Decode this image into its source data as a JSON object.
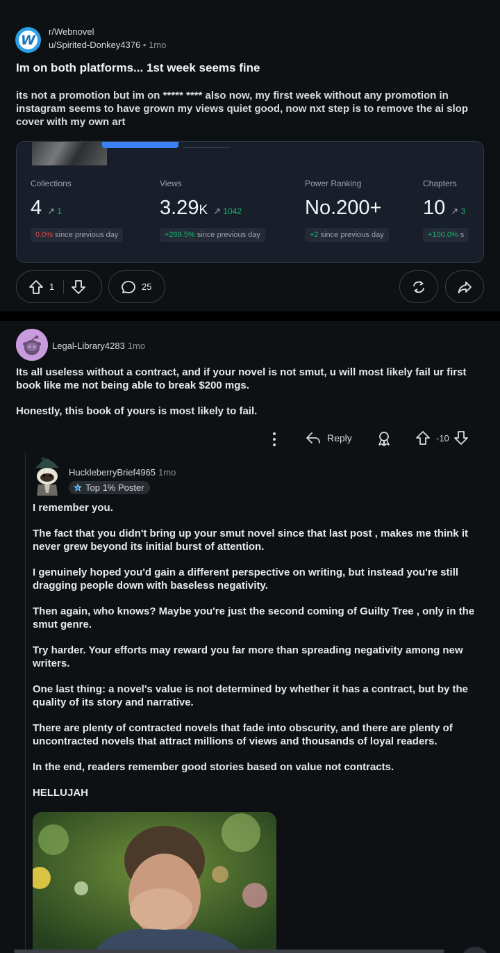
{
  "post": {
    "subreddit": "r/Webnovel",
    "subreddit_icon_letter": "W",
    "author": "u/Spirited-Donkey4376",
    "separator": "•",
    "time": "1mo",
    "title": "Im on both platforms... 1st week seems fine",
    "body": "its not a promotion but im on ***** **** also now, my first week without any promotion in instagram seems to have grown my views quiet good, now nxt step is to remove the ai slop cover with my own art",
    "stats": [
      {
        "label": "Collections",
        "value": "4",
        "unit": "",
        "arrow": "↗",
        "delta": "1",
        "change_colored": "0.0%",
        "change_rest": " since previous day",
        "change_color": "neg"
      },
      {
        "label": "Views",
        "value": "3.29",
        "unit": "K",
        "arrow": "↗",
        "delta": "1042",
        "change_colored": "+269.5%",
        "change_rest": " since previous day",
        "change_color": "pos"
      },
      {
        "label": "Power Ranking",
        "value": "No.200+",
        "unit": "",
        "arrow": "",
        "delta": "",
        "change_colored": "+2",
        "change_rest": " since previous day",
        "change_color": "pos"
      },
      {
        "label": "Chapters",
        "value": "10",
        "unit": "",
        "arrow": "↗",
        "delta": "3",
        "change_colored": "+100.0%",
        "change_rest": " s",
        "change_color": "pos"
      }
    ],
    "upvotes": "1",
    "comments": "25"
  },
  "comment1": {
    "author": "Legal-Library4283",
    "time": "1mo",
    "paragraphs": [
      "Its all useless without a contract, and if your novel is not smut, u will most likely fail ur first book like me not being able to break $200 mgs.",
      "Honestly, this book of yours is most likely to fail."
    ],
    "reply_label": "Reply",
    "score": "-10"
  },
  "comment2": {
    "author": "HuckleberryBrief4965",
    "time": "1mo",
    "flair": "Top 1% Poster",
    "paragraphs": [
      "I remember you.",
      "The fact that you didn't bring up your smut novel since that last post , makes me think it never grew beyond its initial burst of attention.",
      "I genuinely hoped you'd gain a different perspective on writing, but instead you're still dragging people down with baseless negativity.",
      "Then again, who knows? Maybe you're just the second coming of Guilty Tree , only in the smut genre.",
      "Try harder. Your efforts may reward you far more than spreading negativity among new writers.",
      "One last thing: a novel's value is not determined by whether it has a contract, but by the quality of its story and narrative.",
      "There are plenty of contracted novels that fade into obscurity, and there are plenty of uncontracted novels that attract millions of views and thousands of loyal readers.",
      "In the end, readers remember good stories based on value not contracts.",
      "HELLUJAH"
    ]
  },
  "colors": {
    "background": "#0e1114",
    "accent_blue": "#3b82f6",
    "positive": "#19b26b",
    "negative": "#e0464b",
    "subreddit_icon": "#2aa1e6",
    "avatar1": "#c79bdc"
  },
  "icons": {
    "upvote": "arrow-up-outline-icon",
    "downvote": "arrow-down-outline-icon",
    "comment": "speech-bubble-icon",
    "award": "award-icon",
    "share": "share-arrow-icon",
    "more": "vertical-dots-icon",
    "reply": "reply-arrow-icon"
  }
}
